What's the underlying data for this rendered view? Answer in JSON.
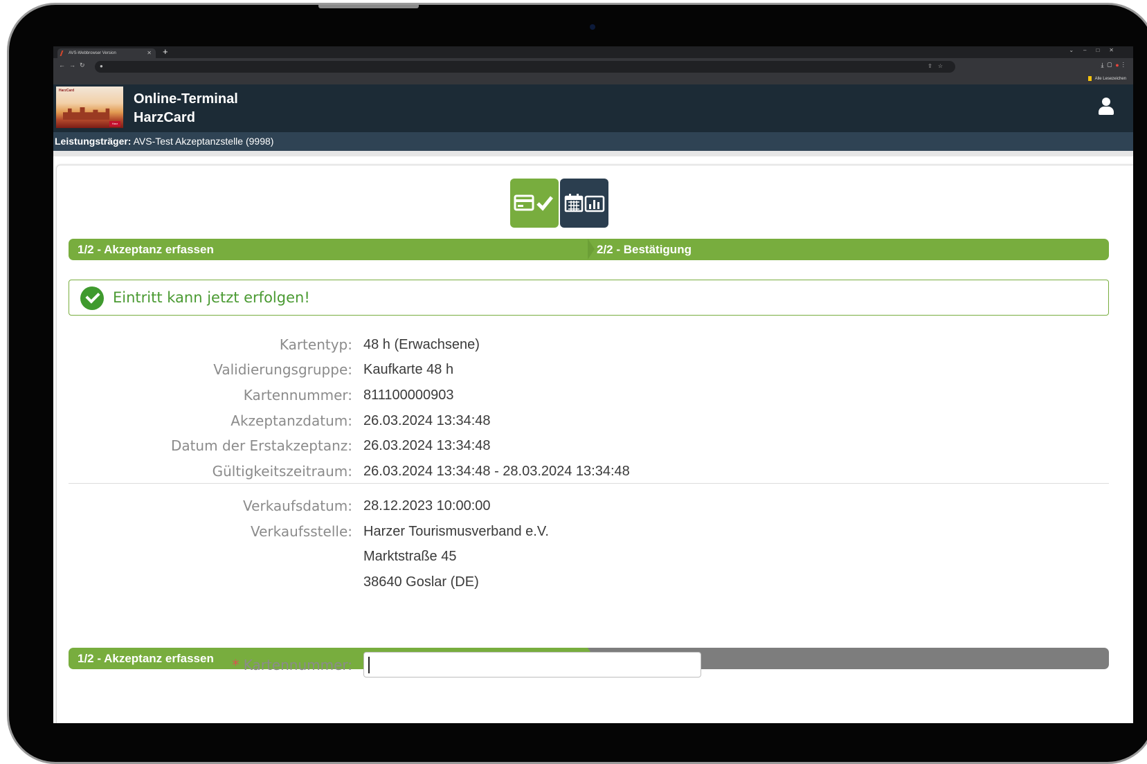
{
  "browser": {
    "tab_title": "AVS-Webbrowser Version",
    "bookmark_label": "Alle Lesezeichen"
  },
  "header": {
    "title_line1": "Online-Terminal",
    "title_line2": "HarzCard"
  },
  "provider": {
    "label": "Leistungsträger:",
    "value": "AVS-Test Akzeptanzstelle (9998)"
  },
  "steps": {
    "step1": "1/2 - Akzeptanz erfassen",
    "step2": "2/2 - Bestätigung"
  },
  "alert": {
    "message": "Eintritt kann jetzt erfolgen!"
  },
  "details": [
    {
      "label": "Kartentyp:",
      "value": "48 h (Erwachsene)"
    },
    {
      "label": "Validierungsgruppe:",
      "value": "Kaufkarte 48 h"
    },
    {
      "label": "Kartennummer:",
      "value": "811100000903"
    },
    {
      "label": "Akzeptanzdatum:",
      "value": "26.03.2024 13:34:48"
    },
    {
      "label": "Datum der Erstakzeptanz:",
      "value": "26.03.2024 13:34:48"
    },
    {
      "label": "Gültigkeitszeitraum:",
      "value": "26.03.2024 13:34:48 - 28.03.2024 13:34:48"
    }
  ],
  "sale": [
    {
      "label": "Verkaufsdatum:",
      "value": "28.12.2023 10:00:00"
    },
    {
      "label": "Verkaufsstelle:",
      "value": "Harzer Tourismusverband e.V."
    },
    {
      "label": "",
      "value": "Marktstraße 45"
    },
    {
      "label": "",
      "value": "38640 Goslar (DE)"
    }
  ],
  "form": {
    "required_mark": "*",
    "card_number_label": "Kartennummer:",
    "card_number_value": ""
  },
  "colors": {
    "header_bg": "#1c2b36",
    "provider_bg": "#2f4354",
    "step_green": "#78ad3e",
    "step_gray": "#7d7d7d",
    "success_green": "#3f9a2e"
  },
  "icons": [
    "card-check-icon",
    "calendar-chart-icon",
    "user-icon",
    "success-check-icon"
  ]
}
